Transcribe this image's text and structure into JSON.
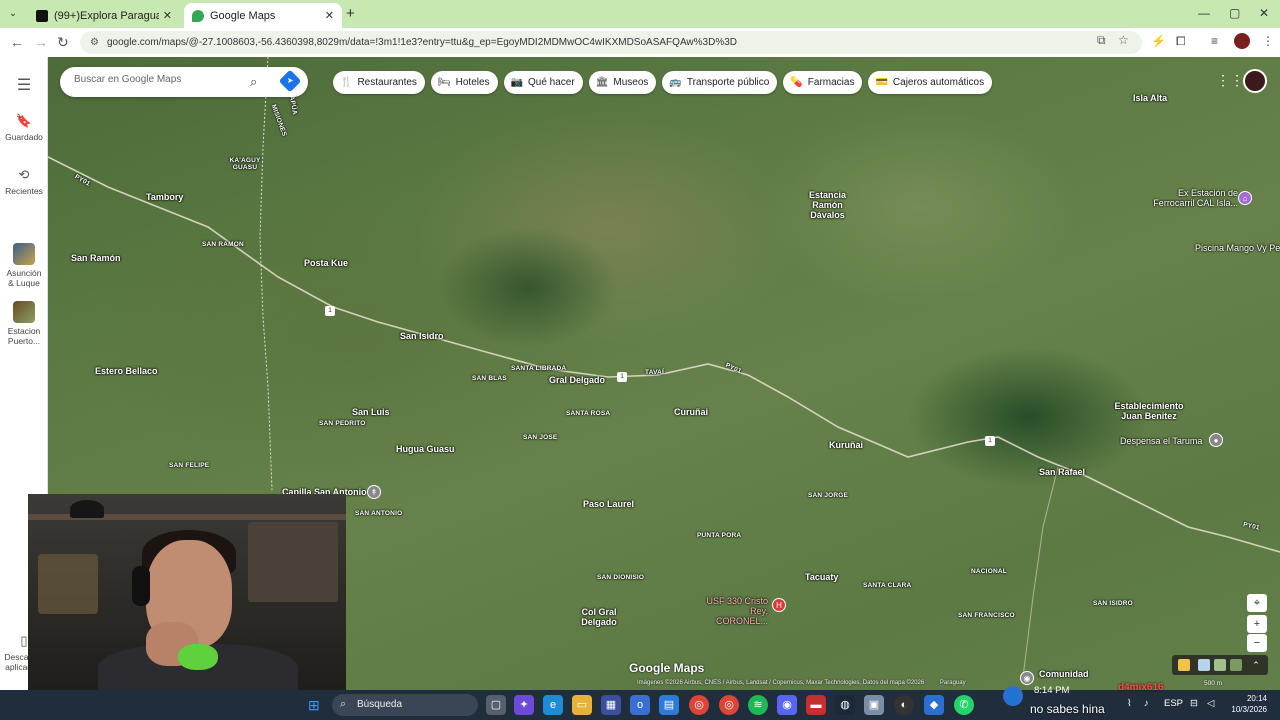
{
  "browser": {
    "tabs": [
      {
        "title": "(99+)Explora Paraguay: Ofertas",
        "close": "✕"
      },
      {
        "title": "Google Maps",
        "close": "✕"
      }
    ],
    "new_tab": "+",
    "url": "google.com/maps/@-27.1008603,-56.4360398,8029m/data=!3m1!1e3?entry=ttu&g_ep=EgoyMDI2MDMwOC4wIKXMDSoASAFQAw%3D%3D",
    "window_controls": [
      "—",
      "▢",
      "✕"
    ]
  },
  "rail": {
    "menu_icon": "☰",
    "items": [
      {
        "label": "Guardado",
        "icon": "bookmark-icon"
      },
      {
        "label": "Recientes",
        "icon": "history-icon"
      },
      {
        "label": "Asunción & Luque"
      },
      {
        "label": "Estacion Puerto..."
      },
      {
        "label": "Descargar aplicación"
      }
    ]
  },
  "search": {
    "placeholder": "Buscar en Google Maps"
  },
  "chips": [
    {
      "label": "Restaurantes",
      "icon": "🍴"
    },
    {
      "label": "Hoteles",
      "icon": "🛏"
    },
    {
      "label": "Qué hacer",
      "icon": "📷"
    },
    {
      "label": "Museos",
      "icon": "🏛"
    },
    {
      "label": "Transporte público",
      "icon": "🚌"
    },
    {
      "label": "Farmacias",
      "icon": "💊"
    },
    {
      "label": "Cajeros automáticos",
      "icon": "💳"
    }
  ],
  "map": {
    "places": [
      {
        "name": "Isla Alta"
      },
      {
        "name": "Tambory"
      },
      {
        "name": "KA'AGUY GUASU"
      },
      {
        "name": "SAN RAMON"
      },
      {
        "name": "San Ramón"
      },
      {
        "name": "Posta Kue"
      },
      {
        "name": "Estancia Ramón Dávalos"
      },
      {
        "name": "San Isidro"
      },
      {
        "name": "SANTA LIBRADA"
      },
      {
        "name": "SAN BLAS"
      },
      {
        "name": "Gral Delgado"
      },
      {
        "name": "TAVAÍ"
      },
      {
        "name": "Estero Bellaco"
      },
      {
        "name": "SANTA ROSA"
      },
      {
        "name": "Curuñai"
      },
      {
        "name": "San Luis"
      },
      {
        "name": "SAN PEDRITO"
      },
      {
        "name": "SAN JOSE"
      },
      {
        "name": "Kuruñai"
      },
      {
        "name": "Hugua Guasu"
      },
      {
        "name": "SAN FELIPE"
      },
      {
        "name": "Capilla San Antonio"
      },
      {
        "name": "SAN ANTONIO"
      },
      {
        "name": "Paso Laurel"
      },
      {
        "name": "SAN JORGE"
      },
      {
        "name": "San Rafael"
      },
      {
        "name": "Establecimiento Juan Benitez"
      },
      {
        "name": "PUNTA PORA"
      },
      {
        "name": "SAN DIONISIO"
      },
      {
        "name": "Tacuaty"
      },
      {
        "name": "SANTA CLARA"
      },
      {
        "name": "NACIONAL"
      },
      {
        "name": "SAN FRANCISCO"
      },
      {
        "name": "SAN ISIDRO"
      },
      {
        "name": "Col Gral Delgado"
      },
      {
        "name": "Comunidad"
      },
      {
        "name": "ITAPÚA"
      },
      {
        "name": "MISIONES"
      }
    ],
    "pois": [
      {
        "name": "Ex Estación de Ferrocarril CAL Isla...",
        "icon": "museum-icon"
      },
      {
        "name": "Piscina Mango Vy Pe"
      },
      {
        "name": "Despensa el Taruma",
        "icon": "store-icon"
      },
      {
        "name": "USF 330 Cristo Rey, CORONEL...",
        "icon": "hospital-icon"
      }
    ],
    "route_labels": [
      "PY01",
      "1",
      "PY01",
      "1",
      "1",
      "PY01"
    ],
    "logo": "Google Maps",
    "attribution": "Imágenes ©2026 Airbus, CNES / Airbus, Landsat / Copernicus, Maxar Technologies, Datos del mapa ©2026",
    "country": "Paraguay",
    "scale": "500 m",
    "controls": [
      "⌖",
      "+",
      "−"
    ]
  },
  "taskbar": {
    "search_label": "Búsqueda",
    "overlay_time": "8:14 PM",
    "overlay_user": "d4mix616",
    "overlay_msg": "no sabes hina",
    "lang": "ESP",
    "clock_time": "20:14",
    "clock_date": "10/3/2026"
  }
}
